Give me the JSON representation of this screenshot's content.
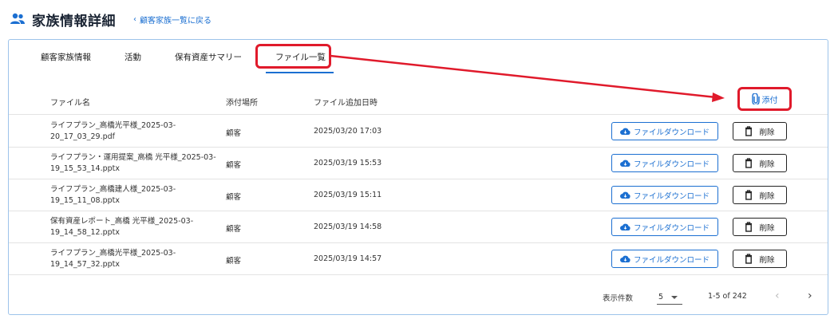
{
  "header": {
    "title": "家族情報詳細",
    "back_link": "顧客家族一覧に戻る"
  },
  "tabs": [
    {
      "label": "顧客家族情報",
      "active": false
    },
    {
      "label": "活動",
      "active": false
    },
    {
      "label": "保有資産サマリー",
      "active": false
    },
    {
      "label": "ファイル一覧",
      "active": true
    }
  ],
  "table": {
    "columns": {
      "name": "ファイル名",
      "location": "添付場所",
      "date": "ファイル追加日時"
    },
    "attach_label": "添付",
    "download_label": "ファイルダウンロード",
    "delete_label": "削除",
    "rows": [
      {
        "name": "ライフプラン_高橋光平様_2025-03-20_17_03_29.pdf",
        "location": "顧客",
        "date": "2025/03/20 17:03"
      },
      {
        "name": "ライフプラン・運用提案_高橋 光平様_2025-03-19_15_53_14.pptx",
        "location": "顧客",
        "date": "2025/03/19 15:53"
      },
      {
        "name": "ライフプラン_高橋建人様_2025-03-19_15_11_08.pptx",
        "location": "顧客",
        "date": "2025/03/19 15:11"
      },
      {
        "name": "保有資産レポート_高橋 光平様_2025-03-19_14_58_12.pptx",
        "location": "顧客",
        "date": "2025/03/19 14:58"
      },
      {
        "name": "ライフプラン_高橋光平様_2025-03-19_14_57_32.pptx",
        "location": "顧客",
        "date": "2025/03/19 14:57"
      }
    ]
  },
  "pagination": {
    "per_page_label": "表示件数",
    "per_page_value": "5",
    "range_text": "1-5 of 242"
  },
  "colors": {
    "accent": "#1b6fd1",
    "highlight": "#e01a2b"
  }
}
